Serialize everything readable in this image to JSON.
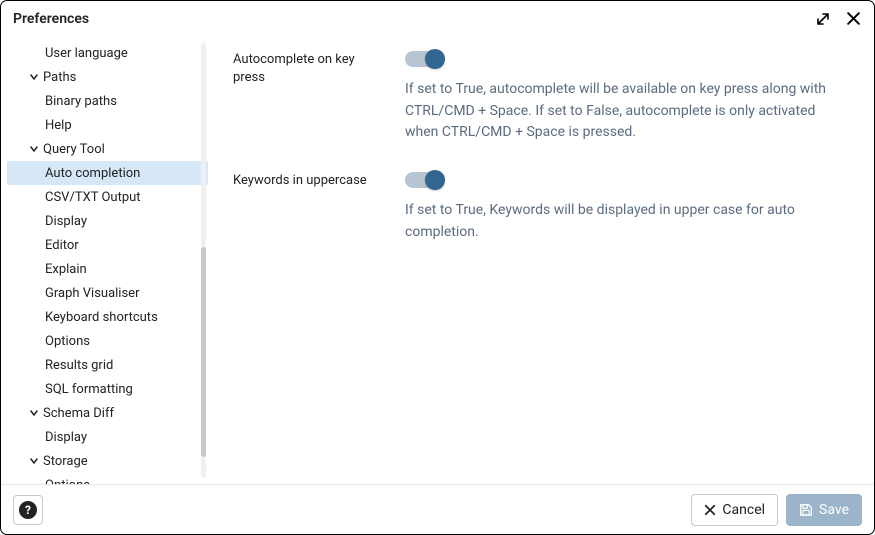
{
  "dialog": {
    "title": "Preferences"
  },
  "sidebar": {
    "items": [
      {
        "label": "User language",
        "level": 2,
        "expandable": false
      },
      {
        "label": "Paths",
        "level": 1,
        "expandable": true,
        "expanded": true
      },
      {
        "label": "Binary paths",
        "level": 2,
        "expandable": false
      },
      {
        "label": "Help",
        "level": 2,
        "expandable": false
      },
      {
        "label": "Query Tool",
        "level": 1,
        "expandable": true,
        "expanded": true
      },
      {
        "label": "Auto completion",
        "level": 2,
        "expandable": false,
        "selected": true
      },
      {
        "label": "CSV/TXT Output",
        "level": 2,
        "expandable": false
      },
      {
        "label": "Display",
        "level": 2,
        "expandable": false
      },
      {
        "label": "Editor",
        "level": 2,
        "expandable": false
      },
      {
        "label": "Explain",
        "level": 2,
        "expandable": false
      },
      {
        "label": "Graph Visualiser",
        "level": 2,
        "expandable": false
      },
      {
        "label": "Keyboard shortcuts",
        "level": 2,
        "expandable": false
      },
      {
        "label": "Options",
        "level": 2,
        "expandable": false
      },
      {
        "label": "Results grid",
        "level": 2,
        "expandable": false
      },
      {
        "label": "SQL formatting",
        "level": 2,
        "expandable": false
      },
      {
        "label": "Schema Diff",
        "level": 1,
        "expandable": true,
        "expanded": true
      },
      {
        "label": "Display",
        "level": 2,
        "expandable": false
      },
      {
        "label": "Storage",
        "level": 1,
        "expandable": true,
        "expanded": true
      },
      {
        "label": "Options",
        "level": 2,
        "expandable": false
      }
    ]
  },
  "settings": [
    {
      "label": "Autocomplete on key press",
      "value": true,
      "description": "If set to True, autocomplete will be available on key press along with CTRL/CMD + Space. If set to False, autocomplete is only activated when CTRL/CMD + Space is pressed."
    },
    {
      "label": "Keywords in uppercase",
      "value": true,
      "description": "If set to True, Keywords will be displayed in upper case for auto completion."
    }
  ],
  "footer": {
    "help": "?",
    "cancel": "Cancel",
    "save": "Save"
  }
}
